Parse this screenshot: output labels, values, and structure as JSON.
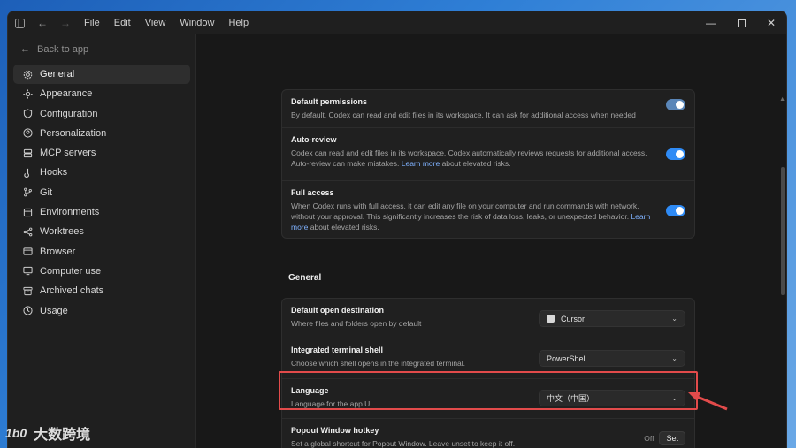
{
  "titlebar": {
    "menus": [
      "File",
      "Edit",
      "View",
      "Window",
      "Help"
    ]
  },
  "sidebar": {
    "back_label": "Back to app",
    "items": [
      {
        "label": "General",
        "icon": "gear-icon"
      },
      {
        "label": "Appearance",
        "icon": "sun-icon"
      },
      {
        "label": "Configuration",
        "icon": "shield-icon"
      },
      {
        "label": "Personalization",
        "icon": "person-circle-icon"
      },
      {
        "label": "MCP servers",
        "icon": "server-icon"
      },
      {
        "label": "Hooks",
        "icon": "hook-icon"
      },
      {
        "label": "Git",
        "icon": "git-branch-icon"
      },
      {
        "label": "Environments",
        "icon": "environment-icon"
      },
      {
        "label": "Worktrees",
        "icon": "worktree-icon"
      },
      {
        "label": "Browser",
        "icon": "browser-icon"
      },
      {
        "label": "Computer use",
        "icon": "computer-icon"
      },
      {
        "label": "Archived chats",
        "icon": "archive-icon"
      },
      {
        "label": "Usage",
        "icon": "usage-icon"
      }
    ]
  },
  "permissions": {
    "default": {
      "title": "Default permissions",
      "desc": "By default, Codex can read and edit files in its workspace. It can ask for additional access when needed"
    },
    "auto_review": {
      "title": "Auto-review",
      "desc": "Codex can read and edit files in its workspace. Codex automatically reviews requests for additional access. Auto-review can make mistakes.",
      "link": "Learn more",
      "tail": "about elevated risks."
    },
    "full_access": {
      "title": "Full access",
      "desc": "When Codex runs with full access, it can edit any file on your computer and run commands with network, without your approval. This significantly increases the risk of data loss, leaks, or unexpected behavior.",
      "link": "Learn more",
      "tail": "about elevated risks."
    }
  },
  "general": {
    "section_title": "General",
    "open_destination": {
      "title": "Default open destination",
      "desc": "Where files and folders open by default",
      "value": "Cursor"
    },
    "terminal_shell": {
      "title": "Integrated terminal shell",
      "desc": "Choose which shell opens in the integrated terminal.",
      "value": "PowerShell"
    },
    "language": {
      "title": "Language",
      "desc": "Language for the app UI",
      "value": "中文（中国）"
    },
    "popout_hotkey": {
      "title": "Popout Window hotkey",
      "desc": "Set a global shortcut for Popout Window. Leave unset to keep it off.",
      "off_label": "Off",
      "set_label": "Set"
    }
  },
  "watermark": {
    "logo": "1b0",
    "text": "大数跨境"
  },
  "colors": {
    "accent": "#2f8bf5",
    "highlight": "#e24b4b",
    "link": "#7fb2ff"
  }
}
